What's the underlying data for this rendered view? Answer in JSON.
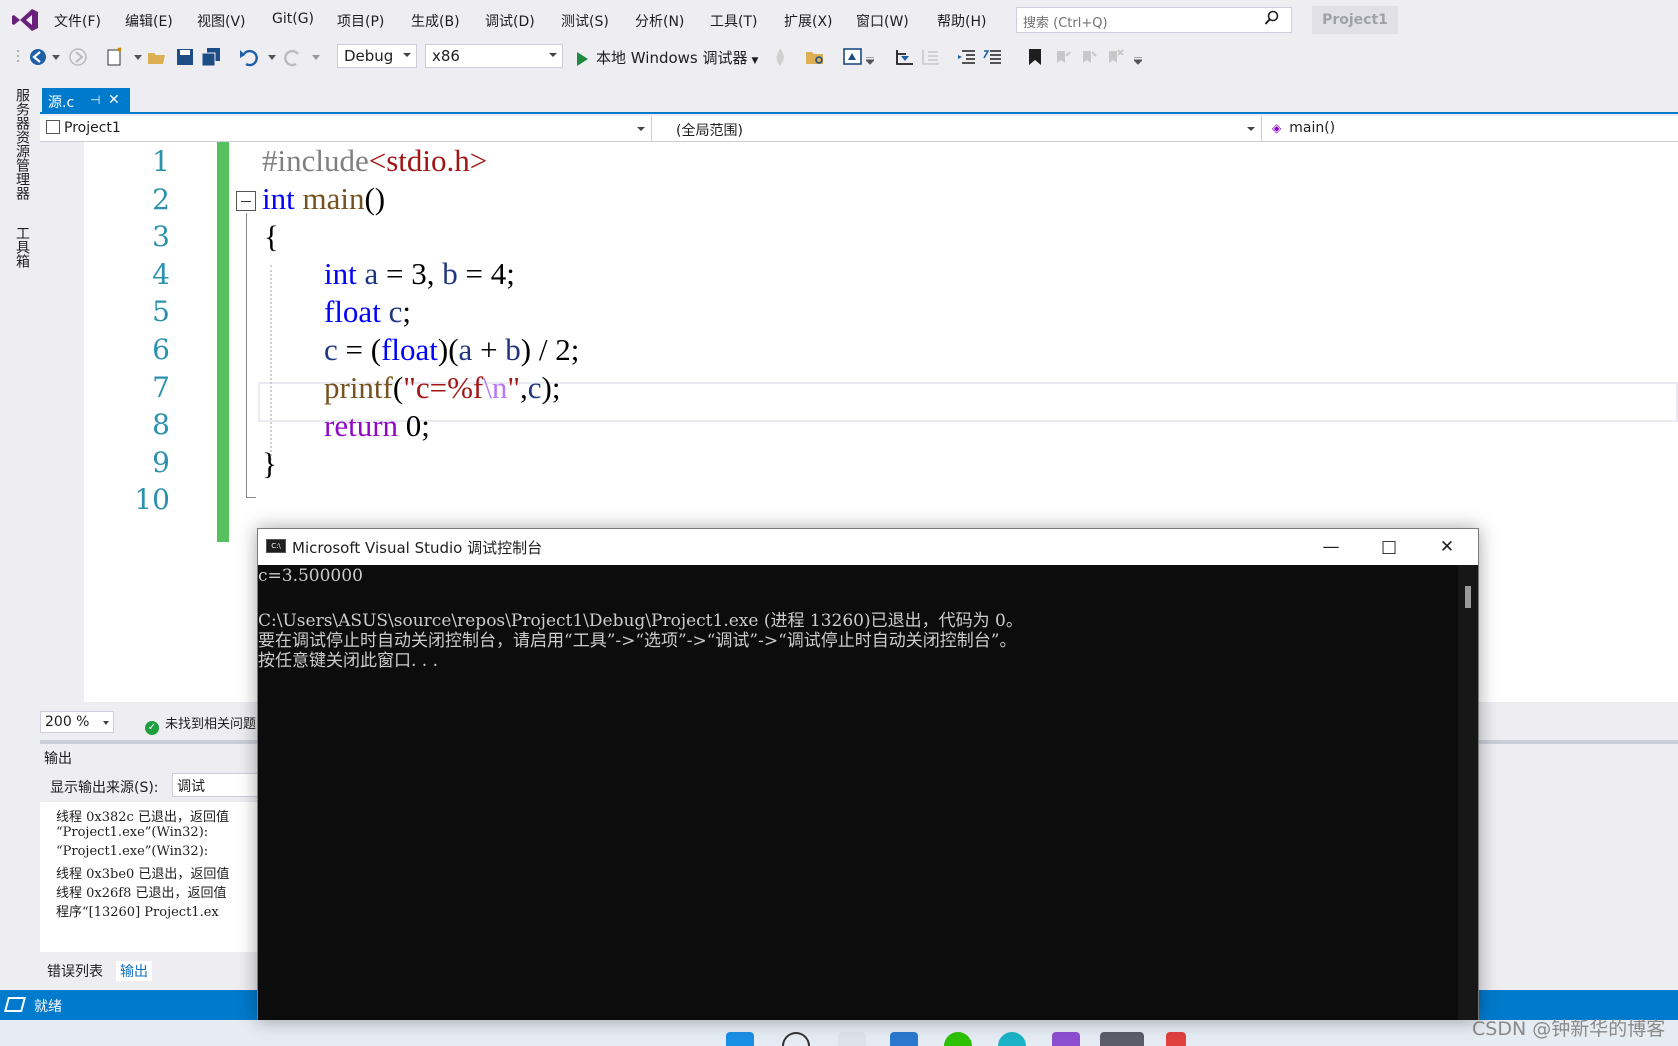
{
  "menu": {
    "items": [
      "文件(F)",
      "编辑(E)",
      "视图(V)",
      "Git(G)",
      "项目(P)",
      "生成(B)",
      "调试(D)",
      "测试(S)",
      "分析(N)",
      "工具(T)",
      "扩展(X)",
      "窗口(W)",
      "帮助(H)"
    ],
    "search_placeholder": "搜索 (Ctrl+Q)",
    "project_badge": "Project1"
  },
  "toolbar": {
    "configuration": "Debug",
    "platform": "x86",
    "debug_target": "本地 Windows 调试器"
  },
  "left_rail": {
    "server_explorer": "服务器资源管理器",
    "toolbox": "工具箱"
  },
  "tab": {
    "label": "源.c",
    "pin": "⊣",
    "close": "✕"
  },
  "navbar": {
    "project": "Project1",
    "scope": "(全局范围)",
    "member": "main()"
  },
  "editor": {
    "line_numbers": [
      "1",
      "2",
      "3",
      "4",
      "5",
      "6",
      "7",
      "8",
      "9",
      "10"
    ],
    "lines": {
      "l1": {
        "pp": "#include",
        "hdr": "<stdio.h>"
      },
      "l2": {
        "kw": "int",
        "fn": " main",
        "rest": "()"
      },
      "l3": "{",
      "l4": {
        "kw": "int",
        "a": " a",
        "eq1": " = 3, ",
        "b": "b",
        "eq2": " = 4;"
      },
      "l5": {
        "kw": "float",
        "c": " c",
        "rest": ";"
      },
      "l6": {
        "c": "c",
        "eq": " = (",
        "kw": "float",
        "p1": ")(",
        "a": "a",
        "plus": " + ",
        "b": "b",
        "rest": ") / 2;"
      },
      "l7": {
        "fn": "printf",
        "p": "(",
        "s1": "\"c=%f",
        "esc": "\\n",
        "s2": "\"",
        "comma": ",",
        "c": "c",
        "rest": ");"
      },
      "l8": {
        "kw": "return",
        "rest": " 0;"
      },
      "l9": "}"
    },
    "zoom": "200 %",
    "issues_text": "未找到相关问题"
  },
  "output": {
    "title": "输出",
    "source_label": "显示输出来源(S):",
    "source_value": "调试",
    "lines": [
      "线程 0x382c 已退出，返回值",
      "“Project1.exe”(Win32):",
      "“Project1.exe”(Win32):",
      "线程 0x3be0 已退出，返回值",
      "线程 0x26f8 已退出，返回值",
      "程序“[13260] Project1.ex"
    ]
  },
  "bottom_tabs": {
    "error_list": "错误列表",
    "output": "输出"
  },
  "statusbar": {
    "ready": "就绪"
  },
  "console": {
    "icon_text": "C:\\",
    "title": "Microsoft Visual Studio 调试控制台",
    "lines": [
      "c=3.500000",
      "",
      "C:\\Users\\ASUS\\source\\repos\\Project1\\Debug\\Project1.exe (进程 13260)已退出，代码为 0。",
      "要在调试停止时自动关闭控制台，请启用“工具”->“选项”->“调试”->“调试停止时自动关闭控制台”。",
      "按任意键关闭此窗口. . ."
    ]
  },
  "watermark": "CSDN @钟新华的博客",
  "colors": {
    "accent": "#007acc",
    "change_bar": "#58c15f",
    "keyword": "#0000ff",
    "control_keyword": "#8f08c4",
    "string": "#a31515",
    "line_number": "#2b91af",
    "console_bg": "#0c0c0c"
  }
}
